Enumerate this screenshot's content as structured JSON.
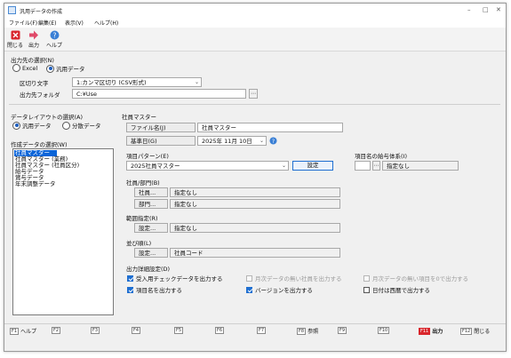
{
  "window": {
    "title": "汎用データの作成",
    "minimize": "–",
    "maximize": "□",
    "close": "✕"
  },
  "menu": [
    "ファイル(F)",
    "編集(E)",
    "表示(V)",
    "ヘルプ(H)"
  ],
  "toolbar": {
    "close": "閉じる",
    "output": "出力",
    "help": "ヘルプ"
  },
  "output_dest": {
    "heading": "出力先の選択(N)",
    "excel": "Excel",
    "generic": "汎用データ",
    "selected": "generic",
    "delimiter_label": "区切り文字",
    "delimiter_value": "1:カンマ区切り (CSV形式)",
    "folder_label": "出力先フォルダ",
    "folder_value": "C:¥Use"
  },
  "layout_select": {
    "heading": "データレイアウトの選択(A)",
    "generic": "汎用データ",
    "category": "分散データ",
    "selected": "generic"
  },
  "data_select": {
    "heading": "作成データの選択(W)",
    "items": [
      "社員マスター",
      "社員マスター (業務)",
      "社員マスター (社員区分)",
      "給与データ",
      "賞与データ",
      "年末調整データ"
    ],
    "selected_index": 0
  },
  "master": {
    "heading": "社員マスター",
    "filename_label": "ファイル名(J)",
    "filename_value": "社員マスター",
    "date_label": "基準日(G)",
    "date_value": "2025年 11月 10日",
    "item_pattern_label": "項目パターン(E)",
    "item_pattern_value": "2025社員マスター",
    "settings_button": "設定",
    "item_name_label": "項目名の給与体系(I)",
    "item_name_value": "指定なし",
    "employee_dept_label": "社員/部門(B)",
    "employee_btn": "社員...",
    "employee_value": "指定なし",
    "dept_btn": "部門...",
    "dept_value": "指定なし",
    "range_label": "範囲指定(R)",
    "range_btn": "設定...",
    "range_value": "指定なし",
    "sort_label": "並び順(L)",
    "sort_btn": "設定...",
    "sort_value": "社員コード",
    "detail_label": "出力詳細設定(D)",
    "options": [
      {
        "label": "受入用チェックデータを出力する",
        "checked": true,
        "disabled": false
      },
      {
        "label": "月次データの無い社員を出力する",
        "checked": false,
        "disabled": true
      },
      {
        "label": "月次データの無い項目を0で出力する",
        "checked": false,
        "disabled": true
      },
      {
        "label": "項目名を出力する",
        "checked": true,
        "disabled": false
      },
      {
        "label": "バージョンを出力する",
        "checked": true,
        "disabled": false
      },
      {
        "label": "日付は西暦で出力する",
        "checked": false,
        "disabled": false
      }
    ]
  },
  "fkeys": [
    {
      "key": "F1",
      "label": "ヘルプ"
    },
    {
      "key": "F2",
      "label": ""
    },
    {
      "key": "F3",
      "label": ""
    },
    {
      "key": "F4",
      "label": ""
    },
    {
      "key": "F5",
      "label": ""
    },
    {
      "key": "F6",
      "label": ""
    },
    {
      "key": "F7",
      "label": ""
    },
    {
      "key": "F8",
      "label": "参照"
    },
    {
      "key": "F9",
      "label": ""
    },
    {
      "key": "F10",
      "label": ""
    },
    {
      "key": "F11",
      "label": "出力"
    },
    {
      "key": "F12",
      "label": "閉じる"
    }
  ],
  "colors": {
    "accent": "#1f6fd1",
    "close_icon": "#d9262c",
    "output_icon": "#e04a6a",
    "help_icon": "#3a7fd5"
  }
}
